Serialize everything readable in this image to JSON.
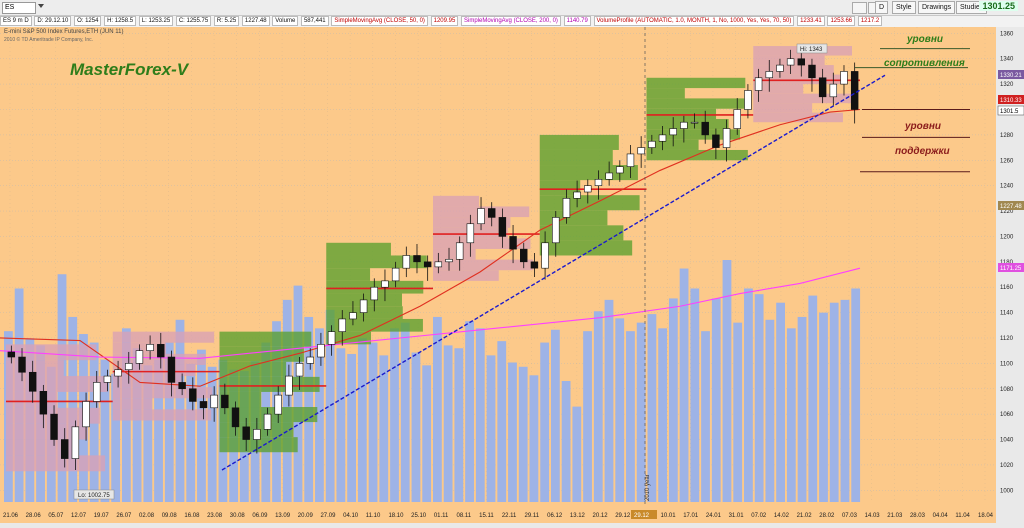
{
  "toolbar": {
    "symbol": "ES",
    "buttons": [
      "D",
      "Style",
      "Drawings",
      "Studies"
    ],
    "last_price": "1301.25"
  },
  "header": {
    "tag": "ES 9 m D",
    "date": "D: 29.12.10",
    "open": "O: 1254",
    "high": "H: 1258.5",
    "low": "L: 1253.25",
    "close": "C: 1255.75",
    "change": "R: 5.25",
    "ohlc_ref": "1227.48",
    "volume_label": "Volume",
    "volume_value": "587,441",
    "sma50_label": "SimpleMovingAvg (CLOSE, 50, 0)",
    "sma50_value": "1209.95",
    "sma200_label": "SimpleMovingAvg (CLOSE, 200, 0)",
    "sma200_value": "1140.79",
    "vp_label": "VolumeProfile (AUTOMATIC, 1.0, MONTH, 1, No, 1000, Yes, Yes, 70, 50)",
    "vp_values": [
      "1233.41",
      "1253.66",
      "1217.2"
    ]
  },
  "chart": {
    "subtitle": "E-mini S&P 500 Index Futures,ETH (JUN 11)",
    "copyright": "2010 © TD Ameritrade IP Company, Inc.",
    "brand": "MasterForex-V",
    "annotations": {
      "resistance_1": "уровни",
      "resistance_2": "сопротивления",
      "support_1": "уровни",
      "support_2": "поддержки"
    },
    "high_label": "Hi: 1343",
    "low_label": "Lo: 1002.75",
    "year_marker": "2010 year",
    "cursor_date": "29.12",
    "price_tags": [
      "1330.21",
      "1310.33",
      "1301.5",
      "1227.48",
      "1171.25"
    ],
    "colors": {
      "background": "#fcc98a",
      "volume": "#9eb3e6",
      "up_profile": "#5aa02e",
      "down_profile": "#d9a2b5",
      "sma50": "#e03020",
      "sma200": "#ff40ff",
      "trendline": "#1a1acc"
    }
  },
  "chart_data": {
    "type": "candlestick",
    "y_axis": {
      "min": 990,
      "max": 1365,
      "ticks": [
        1000,
        1020,
        1040,
        1060,
        1080,
        1100,
        1120,
        1140,
        1160,
        1180,
        1200,
        1220,
        1240,
        1260,
        1280,
        1300,
        1320,
        1340,
        1360
      ]
    },
    "x_ticks": [
      "21.06",
      "28.06",
      "05.07",
      "12.07",
      "19.07",
      "26.07",
      "02.08",
      "09.08",
      "16.08",
      "23.08",
      "30.08",
      "06.09",
      "13.09",
      "20.09",
      "27.09",
      "04.10",
      "11.10",
      "18.10",
      "25.10",
      "01.11",
      "08.11",
      "15.11",
      "22.11",
      "29.11",
      "06.12",
      "13.12",
      "20.12",
      "29.12",
      "03.01",
      "10.01",
      "17.01",
      "24.01",
      "31.01",
      "07.02",
      "14.02",
      "21.02",
      "28.02",
      "07.03",
      "14.03",
      "21.03",
      "28.03",
      "04.04",
      "11.04",
      "18.04"
    ],
    "closes": [
      1105,
      1093,
      1078,
      1060,
      1040,
      1025,
      1050,
      1070,
      1085,
      1090,
      1095,
      1100,
      1110,
      1115,
      1105,
      1085,
      1080,
      1070,
      1065,
      1075,
      1065,
      1050,
      1040,
      1048,
      1060,
      1075,
      1090,
      1100,
      1105,
      1115,
      1125,
      1135,
      1140,
      1150,
      1160,
      1165,
      1175,
      1185,
      1180,
      1176,
      1180,
      1182,
      1195,
      1210,
      1222,
      1215,
      1200,
      1190,
      1180,
      1175,
      1195,
      1215,
      1230,
      1235,
      1240,
      1245,
      1250,
      1255,
      1265,
      1270,
      1275,
      1280,
      1285,
      1290,
      1290,
      1280,
      1270,
      1285,
      1300,
      1315,
      1325,
      1330,
      1335,
      1340,
      1335,
      1325,
      1310,
      1320,
      1330,
      1300
    ],
    "volumes": [
      120,
      150,
      115,
      110,
      95,
      160,
      130,
      118,
      112,
      100,
      90,
      122,
      108,
      96,
      100,
      112,
      128,
      97,
      107,
      95,
      100,
      93,
      92,
      99,
      112,
      127,
      142,
      152,
      130,
      122,
      135,
      108,
      104,
      115,
      112,
      103,
      122,
      126,
      105,
      96,
      130,
      110,
      108,
      127,
      122,
      103,
      113,
      98,
      95,
      89,
      112,
      121,
      85,
      67,
      120,
      134,
      142,
      129,
      120,
      126,
      132,
      122,
      143,
      164,
      150,
      120,
      143,
      170,
      126,
      150,
      146,
      128,
      140,
      122,
      130,
      145,
      133,
      140,
      142,
      150
    ],
    "sma50": [
      [
        0,
        1120
      ],
      [
        80,
        1118
      ],
      [
        140,
        1085
      ],
      [
        200,
        1082
      ],
      [
        250,
        1098
      ],
      [
        300,
        1108
      ],
      [
        360,
        1122
      ],
      [
        420,
        1145
      ],
      [
        480,
        1172
      ],
      [
        540,
        1205
      ],
      [
        600,
        1228
      ],
      [
        660,
        1252
      ],
      [
        720,
        1272
      ],
      [
        780,
        1288
      ],
      [
        830,
        1298
      ],
      [
        860,
        1300
      ]
    ],
    "sma200": [
      [
        0,
        1110
      ],
      [
        100,
        1105
      ],
      [
        200,
        1104
      ],
      [
        300,
        1112
      ],
      [
        400,
        1120
      ],
      [
        500,
        1128
      ],
      [
        600,
        1136
      ],
      [
        680,
        1145
      ],
      [
        740,
        1155
      ],
      [
        800,
        1163
      ],
      [
        860,
        1175
      ]
    ],
    "trendline": [
      [
        222,
        1016
      ],
      [
        885,
        1327
      ]
    ]
  }
}
